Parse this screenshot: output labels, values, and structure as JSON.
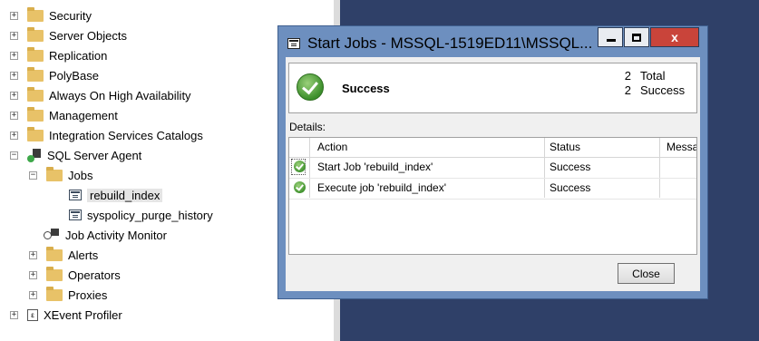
{
  "tree": {
    "items": [
      {
        "label": "Security",
        "expander": "+"
      },
      {
        "label": "Server Objects",
        "expander": "+"
      },
      {
        "label": "Replication",
        "expander": "+"
      },
      {
        "label": "PolyBase",
        "expander": "+"
      },
      {
        "label": "Always On High Availability",
        "expander": "+"
      },
      {
        "label": "Management",
        "expander": "+"
      },
      {
        "label": "Integration Services Catalogs",
        "expander": "+"
      },
      {
        "label": "SQL Server Agent",
        "expander": "−"
      },
      {
        "label": "Jobs",
        "expander": "−"
      },
      {
        "label": "rebuild_index"
      },
      {
        "label": "syspolicy_purge_history"
      },
      {
        "label": "Job Activity Monitor"
      },
      {
        "label": "Alerts",
        "expander": "+"
      },
      {
        "label": "Operators",
        "expander": "+"
      },
      {
        "label": "Proxies",
        "expander": "+"
      },
      {
        "label": "XEvent Profiler",
        "expander": "+"
      }
    ]
  },
  "dialog": {
    "title": "Start Jobs - MSSQL-1519ED11\\MSSQL...",
    "close_glyph": "x",
    "summary": {
      "status": "Success",
      "total_count": "2",
      "total_label": "Total",
      "success_count": "2",
      "success_label": "Success"
    },
    "details_label": "Details:",
    "columns": [
      "Action",
      "Status",
      "Messa"
    ],
    "rows": [
      {
        "action": "Start Job 'rebuild_index'",
        "status": "Success",
        "message": ""
      },
      {
        "action": "Execute job 'rebuild_index'",
        "status": "Success",
        "message": ""
      }
    ],
    "close_button": "Close"
  },
  "colors": {
    "dialog_frame": "#6d8fbf",
    "close_red": "#c9443a",
    "desktop_bg": "#2f4068",
    "success_green": "#3c8f2b"
  }
}
